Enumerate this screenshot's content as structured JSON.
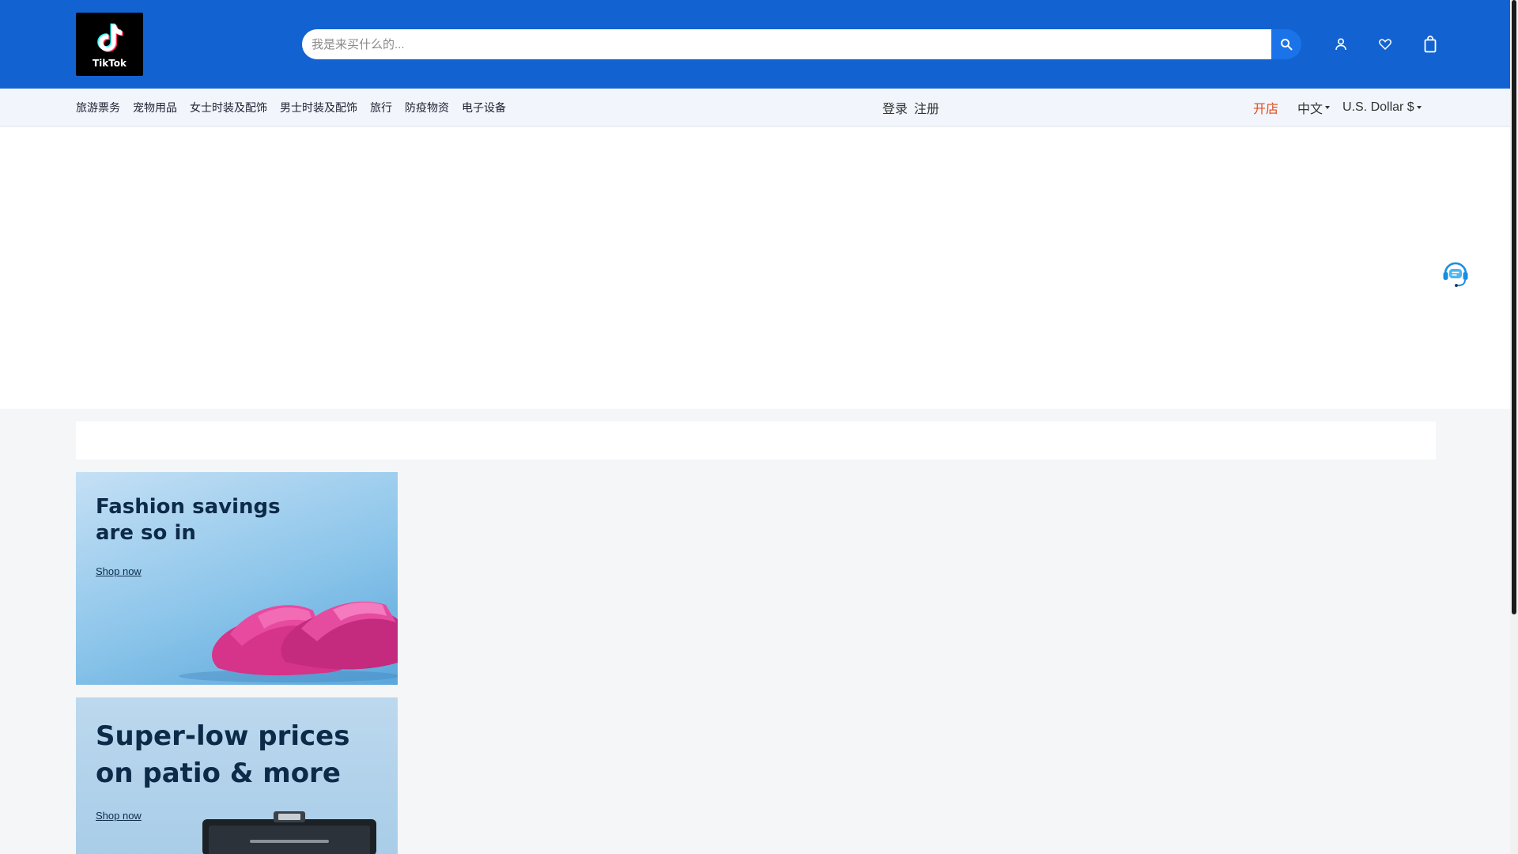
{
  "brand": {
    "logo_text": "TikTok"
  },
  "search": {
    "placeholder": "我是来买什么的..."
  },
  "icons": {
    "search": "search-icon",
    "user": "user-icon",
    "wishlist": "heart-icon",
    "cart": "shopping-bag-icon",
    "support": "headset-chat-icon"
  },
  "nav": {
    "categories": [
      "旅游票务",
      "宠物用品",
      "女士时装及配饰",
      "男士时装及配饰",
      "旅行",
      "防疫物资",
      "电子设备"
    ],
    "login": "登录",
    "register": "注册",
    "open_store": "开店",
    "language": "中文",
    "currency": "U.S. Dollar $"
  },
  "banners": [
    {
      "title": "Fashion savings are so in",
      "link": "Shop now"
    },
    {
      "title": "Super-low prices on patio & more",
      "link": "Shop now"
    }
  ],
  "colors": {
    "header": "#1263d1",
    "search_button": "#1a73e8",
    "open_store": "#e84a1c",
    "nav_bg": "#f2f6fc"
  }
}
